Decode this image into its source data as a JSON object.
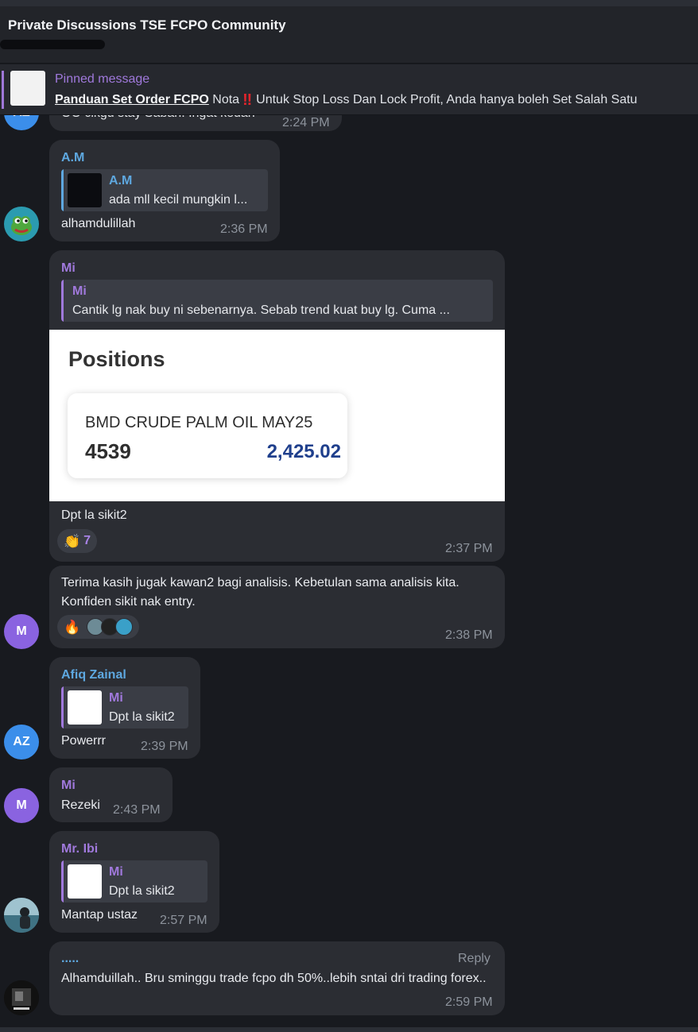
{
  "header": {
    "title": "Private Discussions TSE FCPO Community"
  },
  "pinned": {
    "label": "Pinned message",
    "link_text": "Panduan Set Order FCPO",
    "note": "Nota",
    "bang": "‼",
    "text": "Untuk Stop Loss Dan Lock Profit, Anda hanya boleh Set Salah Satu"
  },
  "messages": {
    "m0": {
      "text": "OO cikgu stay Sabah. Ingat kedah",
      "time": "2:24 PM",
      "avatar": "AZ"
    },
    "m1": {
      "sender": "A.M",
      "quote_name": "A.M",
      "quote_text": "ada mll kecil mungkin l...",
      "text": "alhamdulillah",
      "time": "2:36 PM"
    },
    "m2": {
      "sender": "Mi",
      "quote_name": "Mi",
      "quote_text": "Cantik lg nak buy ni sebenarnya. Sebab trend kuat buy lg. Cuma ...",
      "card": {
        "title": "Positions",
        "name": "BMD CRUDE PALM OIL MAY25",
        "qty": "4539",
        "value": "2,425.02"
      },
      "text": "Dpt la sikit2",
      "reaction_emoji": "👏",
      "reaction_count": "7",
      "time": "2:37 PM"
    },
    "m3": {
      "text": "Terima kasih jugak kawan2 bagi analisis. Kebetulan sama analisis kita. Konfiden sikit nak entry.",
      "reaction_emoji": "🔥",
      "time": "2:38 PM",
      "avatar": "M"
    },
    "m4": {
      "sender": "Afiq Zainal",
      "quote_name": "Mi",
      "quote_text": "Dpt la sikit2",
      "text": "Powerrr",
      "time": "2:39 PM",
      "avatar": "AZ"
    },
    "m5": {
      "sender": "Mi",
      "text": "Rezeki",
      "time": "2:43 PM",
      "avatar": "M"
    },
    "m6": {
      "sender": "Mr. Ibi",
      "quote_name": "Mi",
      "quote_text": "Dpt la sikit2",
      "text": "Mantap ustaz",
      "time": "2:57 PM"
    },
    "m7": {
      "sender": ".....",
      "reply_label": "Reply",
      "text": "Alhamduillah.. Bru sminggu trade fcpo dh 50%..lebih sntai dri trading forex..",
      "time": "2:59 PM"
    }
  },
  "colors": {
    "accent_purple": "#a079dc",
    "accent_blue": "#5ea8e0",
    "bubble": "#2b2d33",
    "background": "#181a1f"
  }
}
